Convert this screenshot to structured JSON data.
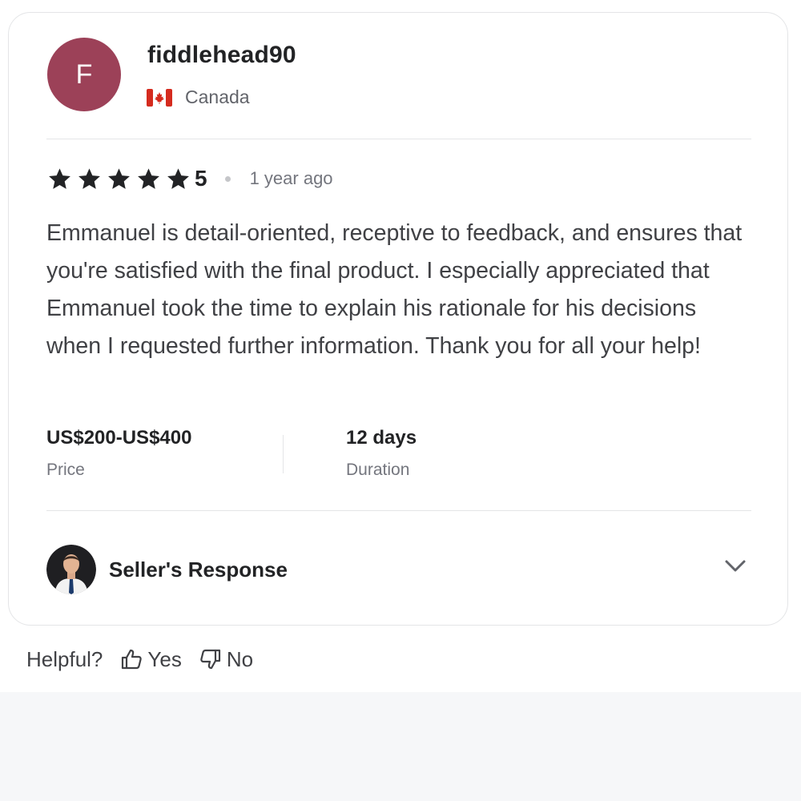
{
  "review": {
    "reviewer": {
      "initial": "F",
      "avatar_color": "#9c4158",
      "username": "fiddlehead90",
      "country": "Canada",
      "flag_icon": "canada-flag-icon"
    },
    "rating": {
      "stars": 5,
      "value": "5",
      "star_icon": "star-icon",
      "star_color": "#222325"
    },
    "time_ago": "1 year ago",
    "text": "Emmanuel is detail-oriented, receptive to feedback, and ensures that you're satisfied with the final product. I especially appreciated that Emmanuel took the time to explain his rationale for his decisions when I requested further information. Thank you for all your help!",
    "price": {
      "value": "US$200-US$400",
      "label": "Price"
    },
    "duration": {
      "value": "12 days",
      "label": "Duration"
    },
    "seller_response": {
      "label": "Seller's Response",
      "avatar_icon": "seller-avatar",
      "toggle_icon": "chevron-down-icon"
    }
  },
  "helpful": {
    "label": "Helpful?",
    "yes_label": "Yes",
    "no_label": "No",
    "yes_icon": "thumbs-up-icon",
    "no_icon": "thumbs-down-icon"
  },
  "colors": {
    "text_primary": "#222325",
    "text_secondary": "#74767e",
    "border": "#e4e5e7",
    "page_background": "#f6f7f9"
  }
}
